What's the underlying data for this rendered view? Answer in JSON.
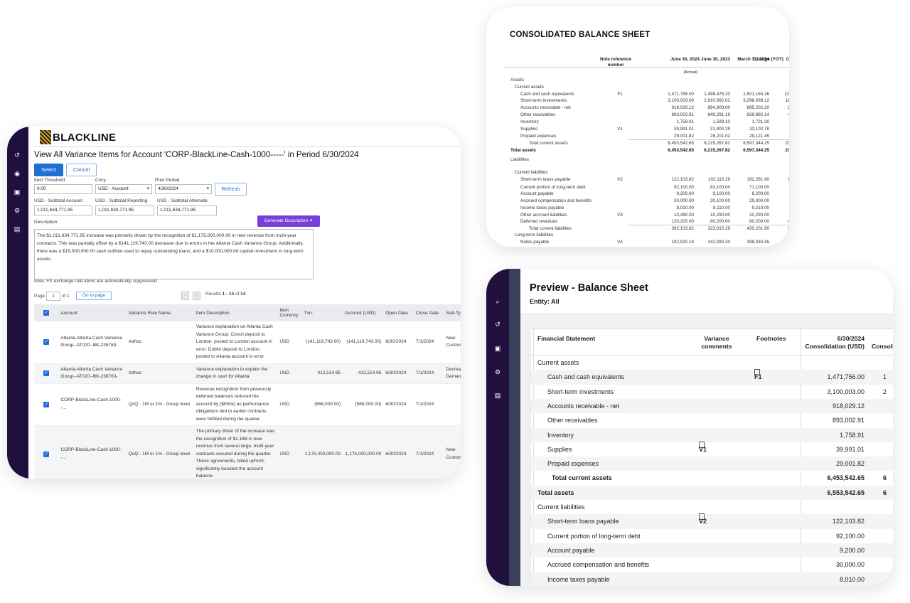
{
  "left_panel": {
    "brand": "BLACKLINE",
    "title": "View All Variance Items for Account 'CORP-BlackLine-Cash-1000-----' in Period 6/30/2024",
    "select_label": "Select",
    "cancel_label": "Cancel",
    "filters": {
      "item_threshold_label": "Item Threshold",
      "item_threshold_value": "0.00",
      "cncy_label": "Cncy.",
      "cncy_value": "USD - Account",
      "prior_period_label": "Prior Period",
      "prior_period_value": "4/30/2024",
      "refresh_label": "Refresh",
      "subtotal_account_label": "USD - Subtotal Account",
      "subtotal_account_value": "1,011,634,771.95",
      "subtotal_reporting_label": "USD - Subtotal Reporting",
      "subtotal_reporting_value": "1,011,634,771.95",
      "subtotal_alternate_label": "USD - Subtotal Alternate",
      "subtotal_alternate_value": "1,011,634,771.95"
    },
    "description_label": "Description",
    "generate_label": "Generate Description",
    "description_text": "The $1,011,634,771.95 increase was primarily driven by the recognition of $1,175,000,000.00 in new revenue from multi-year contracts. This was partially offset by a $141,119,743.00 decrease due to errors in the Atlanta Cash Variance Group. Additionally, there was a $15,000,000.00 cash outflow used to repay outstanding loans, and a $10,000,000.00 capital investment in long-term assets.",
    "fx_note": "Note: FX exchange rate items are automatically suppressed.",
    "pager": {
      "page_label": "Page",
      "page_value": "1",
      "of_label": "of 1",
      "goto_label": "Go to page",
      "results_prefix": "Results ",
      "results_range": "1 - 14",
      "results_of": " of ",
      "results_total": "14"
    },
    "columns": [
      "Account",
      "Variance Rule Name",
      "Item Description",
      "Item Currency",
      "Txn.",
      "Account (USD)",
      "Open Date",
      "Close Date",
      "Sub-Type"
    ],
    "rows": [
      {
        "account": "Atlanta-Atlanta Cash Variance Group--AT020--BK-238763-",
        "rule": "Adhoc",
        "desc": "Variance explanation on Atlanta Cash Variance Group: Czech deposit to London, posted to London account in error. Dublin deposit to London, posted to Atlanta account in error",
        "currency": "USD",
        "txn": "(141,119,743.00)",
        "usd": "(141,119,743.00)",
        "open": "6/30/2024",
        "close": "7/1/2024",
        "subtype": "New Customer"
      },
      {
        "account": "Atlanta-Atlanta Cash Variance Group--AT020--BK-238763-",
        "rule": "Adhoc",
        "desc": "Variance explanation to explain the change in cash for Atlanta",
        "currency": "USD",
        "txn": "412,514.95",
        "usd": "412,514.95",
        "open": "6/30/2024",
        "close": "7/1/2024",
        "subtype": "Decreased Demand"
      },
      {
        "account": "CORP-BlackLine-Cash-1000--...",
        "rule": "QoQ - 1M or 1% - Group level",
        "desc": "Revenue recognition from previously deferred balances reduced the account by ($550k) as performance obligations tied to earlier contracts were fulfilled during the quarter.",
        "currency": "USD",
        "txn": "(568,000.00)",
        "usd": "(568,000.00)",
        "open": "6/30/2024",
        "close": "7/1/2024",
        "subtype": ""
      },
      {
        "account": "CORP-BlackLine-Cash-1000--...",
        "rule": "QoQ - 1M or 1% - Group level",
        "desc": "The primary driver of the increase was the recognition of $1.18B in new revenue from several large, multi-year contracts secured during the quarter. These agreements, billed upfront, significantly boosted the account balance.",
        "currency": "USD",
        "txn": "1,175,000,000.00",
        "usd": "1,175,000,000.00",
        "open": "6/30/2024",
        "close": "7/1/2024",
        "subtype": "New Customer"
      }
    ]
  },
  "top_panel": {
    "title": "CONSOLIDATED BALANCE SHEET",
    "headers": {
      "note": "Note reference number",
      "c1": "June 30, 2024",
      "c2": "June 30, 2023",
      "c3": "March 31, 2024",
      "c4": "Change (YOY)",
      "actual": "(Actual)",
      "clip": "C"
    },
    "rows": [
      {
        "label": "Assets",
        "indent": 0
      },
      {
        "label": "Current assets",
        "indent": 1
      },
      {
        "label": "Cash and cash equivalents",
        "indent": 2,
        "note": "F1",
        "v": [
          "1,471,756.00",
          "1,498,475.20",
          "1,501,165.26",
          "(26,719.20)"
        ]
      },
      {
        "label": "Short-term investments",
        "indent": 2,
        "v": [
          "3,100,003.00",
          "2,910,992.02",
          "3,298,039.12",
          "189,010.98"
        ]
      },
      {
        "label": "Accounts receivable - net",
        "indent": 2,
        "v": [
          "918,029.12",
          "894,809.00",
          "895,202.20",
          "23,220.00"
        ]
      },
      {
        "label": "Other receivables",
        "indent": 2,
        "v": [
          "893,002.91",
          "849,291.19",
          "839,992.14",
          "43,711.72"
        ]
      },
      {
        "label": "Inventory",
        "indent": 2,
        "v": [
          "1,758.91",
          "1,599.10",
          "1,721.30",
          "159.81"
        ]
      },
      {
        "label": "Supplies",
        "indent": 2,
        "note": "V1",
        "v": [
          "39,991.01",
          "31,900.29",
          "32,102.78",
          "8,090.72"
        ]
      },
      {
        "label": "Prepaid expenses",
        "indent": 2,
        "v": [
          "29,001.82",
          "28,201.02",
          "29,121.45",
          "800.80"
        ]
      },
      {
        "label": "Total current assets",
        "indent": 3,
        "v": [
          "6,453,542.65",
          "6,215,267.82",
          "6,597,344.25",
          "238,274.83"
        ]
      },
      {
        "label": "Total assets",
        "indent": 0,
        "bold": true,
        "v": [
          "6,453,542.65",
          "6,215,267.82",
          "6,597,344.25",
          "238,274.83"
        ]
      },
      {
        "label": "Liabilities",
        "indent": 0
      },
      {
        "label": "Current liabilities",
        "indent": 1
      },
      {
        "label": "Short-term loans payable",
        "indent": 2,
        "note": "V2",
        "v": [
          "122,103.82",
          "102,110.29",
          "192,291.90",
          "19,993.53"
        ]
      },
      {
        "label": "Current portion of long-term debt",
        "indent": 2,
        "v": [
          "92,100.00",
          "83,100.00",
          "71,100.00",
          "9,000.00"
        ]
      },
      {
        "label": "Account payable",
        "indent": 2,
        "v": [
          "9,200.00",
          "9,100.00",
          "8,200.00",
          "100.00"
        ]
      },
      {
        "label": "Accrued compensation and benefits",
        "indent": 2,
        "v": [
          "30,000.00",
          "30,100.00",
          "29,000.00",
          "(100.00)"
        ]
      },
      {
        "label": "Income taxes payable",
        "indent": 2,
        "v": [
          "8,010.00",
          "8,110.00",
          "9,210.00",
          "(100.00)"
        ]
      },
      {
        "label": "Other accrued liabilities",
        "indent": 2,
        "note": "V3",
        "v": [
          "10,490.00",
          "10,290.00",
          "20,290.00",
          "200.00"
        ]
      },
      {
        "label": "Deferred revenues",
        "indent": 2,
        "v": [
          "120,200.00",
          "80,200.00",
          "80,200.00",
          "40,000.00"
        ]
      },
      {
        "label": "Total current liabilities",
        "indent": 3,
        "v": [
          "392,103.82",
          "323,010.29",
          "420,201.90",
          "69,093.53"
        ]
      },
      {
        "label": "Long-term liabilities",
        "indent": 1
      },
      {
        "label": "Notes payable",
        "indent": 2,
        "note": "V4",
        "v": [
          "192,920.19",
          "342,090.20",
          "398,034.45",
          "(149"
        ]
      }
    ]
  },
  "bottom_panel": {
    "title": "Preview - Balance Sheet",
    "entity": "Entity: All",
    "headers": {
      "statement": "Financial Statement",
      "variance": "Variance comments",
      "footnotes": "Footnotes",
      "col1": "6/30/2024 Consolidation (USD)",
      "col2": "Consoli"
    },
    "rows": [
      {
        "label": "Current assets",
        "indent": 0
      },
      {
        "label": "Cash and cash equivalents",
        "indent": 1,
        "foot": "F1",
        "v": "1,471,756.00",
        "v2": "1"
      },
      {
        "label": "Short-term investments",
        "indent": 1,
        "v": "3,100,003.00",
        "v2": "2"
      },
      {
        "label": "Accounts receivable - net",
        "indent": 1,
        "v": "918,029.12",
        "v2": ""
      },
      {
        "label": "Other receivables",
        "indent": 1,
        "v": "893,002.91",
        "v2": ""
      },
      {
        "label": "Inventory",
        "indent": 1,
        "v": "1,758.91",
        "v2": ""
      },
      {
        "label": "Supplies",
        "indent": 1,
        "var": "V1",
        "v": "39,991.01",
        "v2": ""
      },
      {
        "label": "Prepaid expenses",
        "indent": 1,
        "v": "29,001.82",
        "v2": ""
      },
      {
        "label": "Total current assets",
        "indent": 2,
        "bold": true,
        "v": "6,453,542.65",
        "v2": "6"
      },
      {
        "label": "Total assets",
        "indent": 0,
        "bold": true,
        "v": "6,553,542.65",
        "v2": "6"
      },
      {
        "label": "Current liabilities",
        "indent": 0
      },
      {
        "label": "Short-term loans payable",
        "indent": 1,
        "var": "V2",
        "v": "122,103.82",
        "v2": ""
      },
      {
        "label": "Current portion of long-term debt",
        "indent": 1,
        "v": "92,100.00",
        "v2": ""
      },
      {
        "label": "Account payable",
        "indent": 1,
        "v": "9,200.00",
        "v2": ""
      },
      {
        "label": "Accrued compensation and benefits",
        "indent": 1,
        "v": "30,000.00",
        "v2": ""
      },
      {
        "label": "Income taxes payable",
        "indent": 1,
        "v": "8,010.00",
        "v2": ""
      }
    ]
  },
  "colors": {
    "sidebar": "#20103e",
    "primary": "#1f6ed4",
    "generate": "#7a3fd6"
  }
}
